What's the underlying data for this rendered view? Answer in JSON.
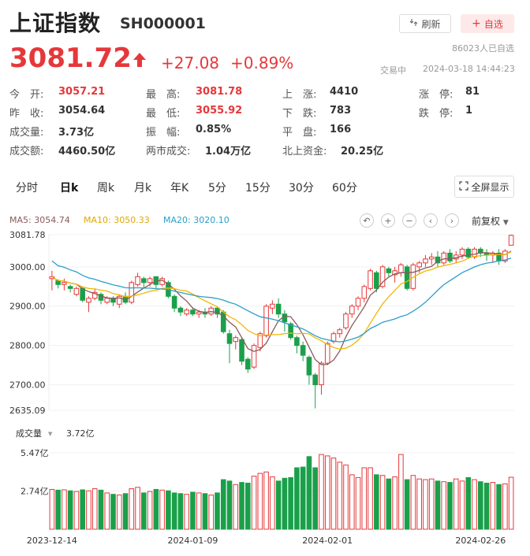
{
  "header": {
    "title": "上证指数",
    "code": "SH000001",
    "refresh_label": "刷新",
    "watch_label": "自选",
    "watchers": "86023人已自选",
    "price": "3081.72",
    "change": "+27.08",
    "change_pct": "+0.89%",
    "status": "交易中",
    "time": "2024-03-18 14:44:23"
  },
  "stats": [
    {
      "label": "今　开:",
      "value": "3057.21",
      "color": "red"
    },
    {
      "label": "最　高:",
      "value": "3081.78",
      "color": "red"
    },
    {
      "label": "上　涨:",
      "value": "4410",
      "color": ""
    },
    {
      "label": "涨　停:",
      "value": "81",
      "color": ""
    },
    {
      "label": "昨　收:",
      "value": "3054.64",
      "color": ""
    },
    {
      "label": "最　低:",
      "value": "3055.92",
      "color": "red"
    },
    {
      "label": "下　跌:",
      "value": "783",
      "color": ""
    },
    {
      "label": "跌　停:",
      "value": "1",
      "color": ""
    },
    {
      "label": "成交量:",
      "value": "3.73亿",
      "color": ""
    },
    {
      "label": "振　幅:",
      "value": "0.85%",
      "color": ""
    },
    {
      "label": "平　盘:",
      "value": "166",
      "color": ""
    },
    {
      "label": "成交额:",
      "value": "4460.50亿",
      "color": ""
    },
    {
      "label": "两市成交:",
      "value": "1.04万亿",
      "color": ""
    },
    {
      "label": "北上资金:",
      "value": "20.25亿",
      "color": ""
    }
  ],
  "tabs": [
    "分时",
    "日k",
    "周k",
    "月k",
    "年K",
    "5分",
    "15分",
    "30分",
    "60分"
  ],
  "active_tab": 1,
  "fullscreen_label": "全屏显示",
  "ma": {
    "ma5": "MA5: 3054.74",
    "ma10": "MA10: 3050.33",
    "ma20": "MA20: 3020.10"
  },
  "adjust_label": "前复权",
  "volume": {
    "label": "成交量",
    "value": "3.72亿"
  },
  "colors": {
    "up": "#e5383b",
    "down": "#1aa04a",
    "ma5": "#8b5a5a",
    "ma10": "#f2b705",
    "ma20": "#2a9fc9"
  },
  "chart_data": {
    "type": "candlestick",
    "y_ticks": [
      "3081.78",
      "3000.00",
      "2900.00",
      "2800.00",
      "2700.00",
      "2635.09"
    ],
    "y_tick_values": [
      3081.78,
      3000,
      2900,
      2800,
      2700,
      2635.09
    ],
    "ylim": [
      2635.09,
      3081.78
    ],
    "vol_ticks": [
      "5.47亿",
      "2.74亿"
    ],
    "vol_tick_values": [
      5.47,
      2.74
    ],
    "vol_max": 5.47,
    "x_labels": [
      "2023-12-14",
      "2024-01-09",
      "2024-02-01",
      "2024-02-26"
    ],
    "x_label_index": [
      0,
      23,
      45,
      70
    ],
    "candles": [
      [
        2970,
        2975,
        2940,
        2990
      ],
      [
        2965,
        2955,
        2945,
        2968
      ],
      [
        2955,
        2960,
        2940,
        2970
      ],
      [
        2950,
        2945,
        2935,
        2955
      ],
      [
        2930,
        2945,
        2925,
        2950
      ],
      [
        2945,
        2915,
        2910,
        2950
      ],
      [
        2910,
        2920,
        2885,
        2925
      ],
      [
        2920,
        2935,
        2915,
        2945
      ],
      [
        2930,
        2915,
        2905,
        2935
      ],
      [
        2910,
        2920,
        2905,
        2925
      ],
      [
        2920,
        2910,
        2900,
        2925
      ],
      [
        2905,
        2925,
        2895,
        2930
      ],
      [
        2925,
        2910,
        2905,
        2935
      ],
      [
        2910,
        2960,
        2905,
        2965
      ],
      [
        2955,
        2975,
        2950,
        2985
      ],
      [
        2970,
        2960,
        2945,
        2975
      ],
      [
        2960,
        2970,
        2950,
        2975
      ],
      [
        2975,
        2955,
        2945,
        2975
      ],
      [
        2955,
        2970,
        2950,
        2975
      ],
      [
        2960,
        2925,
        2920,
        2965
      ],
      [
        2925,
        2895,
        2885,
        2930
      ],
      [
        2895,
        2885,
        2875,
        2900
      ],
      [
        2880,
        2890,
        2875,
        2895
      ],
      [
        2890,
        2880,
        2875,
        2895
      ],
      [
        2880,
        2885,
        2870,
        2890
      ],
      [
        2885,
        2880,
        2870,
        2895
      ],
      [
        2880,
        2895,
        2875,
        2900
      ],
      [
        2895,
        2880,
        2870,
        2900
      ],
      [
        2885,
        2835,
        2830,
        2890
      ],
      [
        2830,
        2805,
        2755,
        2840
      ],
      [
        2810,
        2820,
        2790,
        2825
      ],
      [
        2815,
        2760,
        2750,
        2820
      ],
      [
        2765,
        2740,
        2730,
        2770
      ],
      [
        2745,
        2800,
        2740,
        2805
      ],
      [
        2795,
        2830,
        2785,
        2835
      ],
      [
        2825,
        2900,
        2820,
        2905
      ],
      [
        2895,
        2905,
        2880,
        2915
      ],
      [
        2905,
        2880,
        2870,
        2920
      ],
      [
        2880,
        2860,
        2835,
        2890
      ],
      [
        2855,
        2820,
        2815,
        2860
      ],
      [
        2820,
        2800,
        2780,
        2825
      ],
      [
        2800,
        2775,
        2760,
        2810
      ],
      [
        2770,
        2725,
        2700,
        2775
      ],
      [
        2725,
        2700,
        2640,
        2730
      ],
      [
        2700,
        2755,
        2675,
        2760
      ],
      [
        2755,
        2805,
        2750,
        2810
      ],
      [
        2810,
        2830,
        2805,
        2835
      ],
      [
        2830,
        2840,
        2820,
        2845
      ],
      [
        2845,
        2880,
        2840,
        2885
      ],
      [
        2880,
        2900,
        2870,
        2905
      ],
      [
        2900,
        2920,
        2890,
        2925
      ],
      [
        2920,
        2950,
        2910,
        2955
      ],
      [
        2945,
        2990,
        2940,
        2995
      ],
      [
        2985,
        2945,
        2935,
        2990
      ],
      [
        2950,
        3000,
        2945,
        3005
      ],
      [
        2995,
        2985,
        2975,
        3000
      ],
      [
        2980,
        2990,
        2960,
        3000
      ],
      [
        2985,
        3005,
        2975,
        3010
      ],
      [
        3000,
        2945,
        2940,
        3005
      ],
      [
        2945,
        3005,
        2940,
        3010
      ],
      [
        3000,
        3010,
        2985,
        3015
      ],
      [
        3010,
        3020,
        3000,
        3030
      ],
      [
        3020,
        3025,
        3005,
        3035
      ],
      [
        3025,
        3010,
        3000,
        3040
      ],
      [
        3010,
        3035,
        3005,
        3040
      ],
      [
        3035,
        3015,
        3010,
        3045
      ],
      [
        3020,
        3030,
        3010,
        3040
      ],
      [
        3030,
        3045,
        3020,
        3050
      ],
      [
        3045,
        3025,
        3020,
        3050
      ],
      [
        3025,
        3045,
        3020,
        3050
      ],
      [
        3045,
        3035,
        3025,
        3050
      ],
      [
        3035,
        3030,
        3015,
        3045
      ],
      [
        3030,
        3035,
        3010,
        3040
      ],
      [
        3035,
        3015,
        3005,
        3045
      ],
      [
        3015,
        3040,
        3010,
        3045
      ],
      [
        3055,
        3080,
        3055,
        3082
      ]
    ],
    "volumes": [
      2.85,
      2.8,
      2.82,
      2.75,
      2.7,
      2.82,
      2.75,
      2.9,
      2.8,
      2.6,
      2.5,
      2.45,
      2.55,
      2.9,
      3.0,
      2.6,
      2.7,
      2.85,
      2.8,
      2.75,
      2.6,
      2.55,
      2.5,
      2.65,
      2.6,
      2.55,
      2.45,
      2.6,
      3.55,
      3.45,
      3.2,
      3.35,
      3.3,
      3.8,
      4.0,
      4.1,
      3.75,
      3.45,
      3.65,
      3.7,
      4.4,
      4.45,
      5.2,
      4.4,
      5.35,
      5.25,
      5.1,
      4.8,
      4.6,
      3.9,
      3.7,
      4.4,
      4.4,
      3.9,
      3.85,
      3.6,
      3.75,
      5.35,
      3.55,
      3.85,
      3.6,
      3.55,
      3.6,
      3.45,
      3.4,
      3.35,
      3.6,
      3.45,
      3.7,
      3.55,
      3.4,
      3.3,
      3.35,
      3.2,
      3.25,
      3.72
    ]
  }
}
